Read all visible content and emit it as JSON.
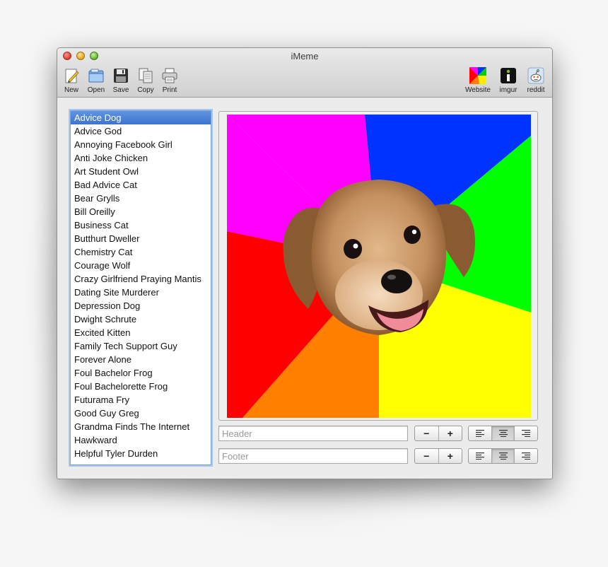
{
  "window": {
    "title": "iMeme"
  },
  "toolbar": {
    "left": [
      {
        "id": "new",
        "label": "New",
        "icon": "new-document-icon"
      },
      {
        "id": "open",
        "label": "Open",
        "icon": "open-folder-icon"
      },
      {
        "id": "save",
        "label": "Save",
        "icon": "floppy-disk-icon"
      },
      {
        "id": "copy",
        "label": "Copy",
        "icon": "copy-icon"
      },
      {
        "id": "print",
        "label": "Print",
        "icon": "printer-icon"
      }
    ],
    "right": [
      {
        "id": "website",
        "label": "Website",
        "icon": "website-colorwheel-icon"
      },
      {
        "id": "imgur",
        "label": "imgur",
        "icon": "imgur-icon"
      },
      {
        "id": "reddit",
        "label": "reddit",
        "icon": "reddit-alien-icon"
      }
    ]
  },
  "meme_list": {
    "selected_index": 0,
    "items": [
      "Advice Dog",
      "Advice God",
      "Annoying Facebook Girl",
      "Anti Joke Chicken",
      "Art Student Owl",
      "Bad Advice Cat",
      "Bear Grylls",
      "Bill Oreilly",
      "Business Cat",
      "Butthurt Dweller",
      "Chemistry Cat",
      "Courage Wolf",
      "Crazy Girlfriend Praying Mantis",
      "Dating Site Murderer",
      "Depression Dog",
      "Dwight Schrute",
      "Excited Kitten",
      "Family Tech Support Guy",
      "Forever Alone",
      "Foul Bachelor Frog",
      "Foul Bachelorette Frog",
      "Futurama Fry",
      "Good Guy Greg",
      "Grandma Finds The Internet",
      "Hawkward",
      "Helpful Tyler Durden"
    ]
  },
  "preview": {
    "image": "advice-dog-meme-image",
    "colors": [
      "#ff00ff",
      "#0033ff",
      "#00ff00",
      "#ffff00",
      "#ff8000",
      "#ff0000"
    ]
  },
  "header": {
    "placeholder": "Header",
    "value": "",
    "minus": "−",
    "plus": "+",
    "alignment": "center"
  },
  "footer": {
    "placeholder": "Footer",
    "value": "",
    "minus": "−",
    "plus": "+",
    "alignment": "center"
  }
}
